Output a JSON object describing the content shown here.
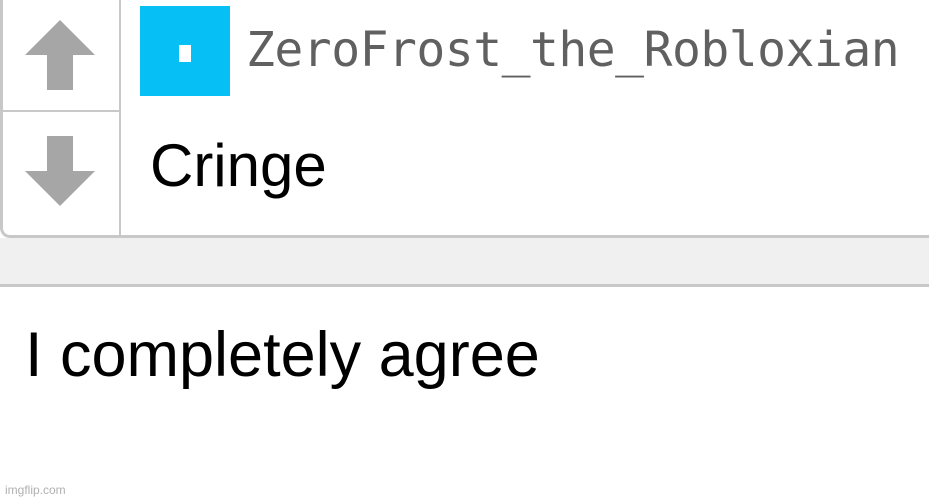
{
  "comment": {
    "username": "ZeroFrost_the_Robloxian",
    "text": "Cringe",
    "avatar_color": "#06c0f5",
    "upvote_icon": "up-arrow-icon",
    "downvote_icon": "down-arrow-icon"
  },
  "reply": {
    "text": "I completely agree"
  },
  "watermark": {
    "text": "imgflip.com"
  },
  "colors": {
    "arrow": "#a6a6a6",
    "border": "#c8c8c8",
    "band": "#f0f0f0",
    "username": "#606060"
  }
}
